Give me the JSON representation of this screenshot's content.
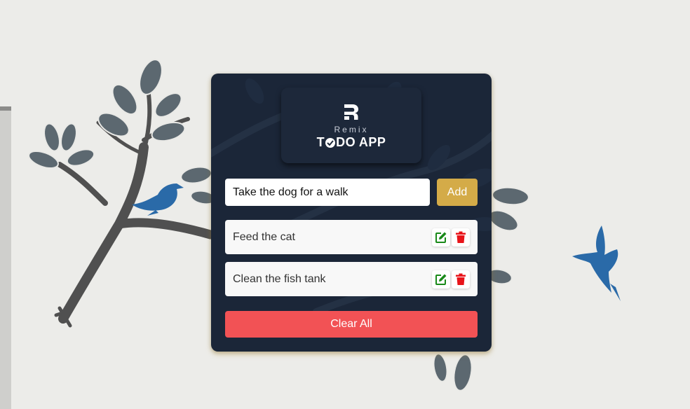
{
  "logo": {
    "brand": "Remix",
    "title_left": "T",
    "title_right": "DO APP"
  },
  "form": {
    "input_value": "Take the dog for a walk",
    "add_label": "Add"
  },
  "todos": [
    {
      "text": "Feed the cat"
    },
    {
      "text": "Clean the fish tank"
    }
  ],
  "clear_label": "Clear All",
  "icons": {
    "edit": "edit-icon",
    "delete": "trash-icon"
  },
  "colors": {
    "card_bg": "#1b2638",
    "add_button": "#d4ab48",
    "clear_button": "#f25255",
    "edit_icon": "#1a8a1a",
    "delete_icon": "#e8141a"
  }
}
